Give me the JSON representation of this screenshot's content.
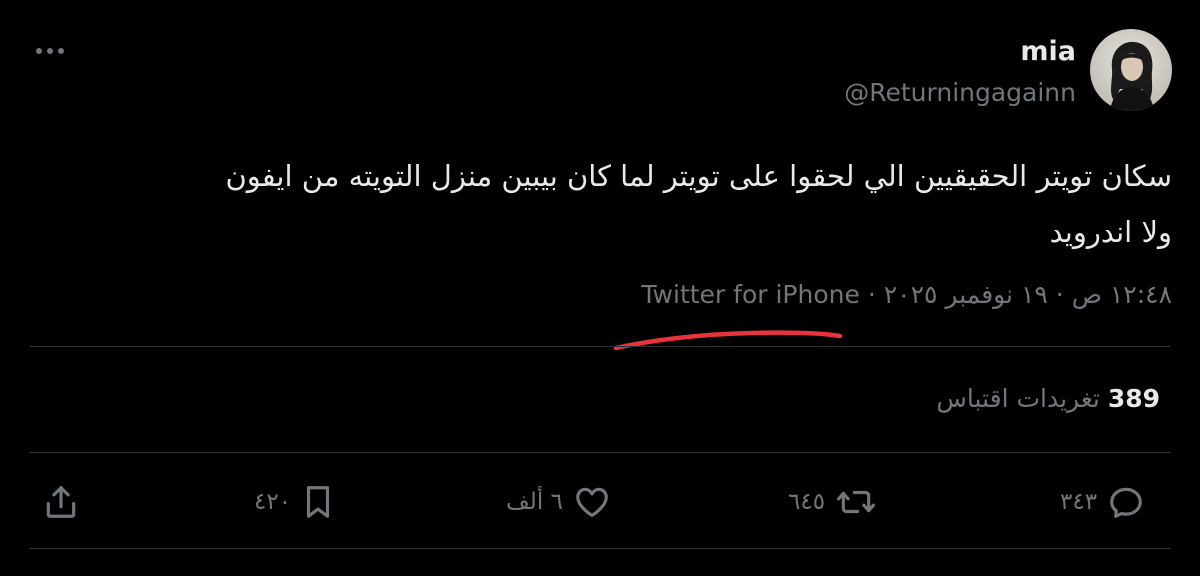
{
  "author": {
    "name": "mia",
    "handle": "@Returningagainn"
  },
  "tweet": {
    "text": "سكان تويتر الحقيقيين الي لحقوا على تويتر لما كان بيبين منزل التويته من ايفون\nولا اندرويد"
  },
  "meta": {
    "time": "١٢:٤٨ ص",
    "date": "١٩ نوفمبر ٢٠٢٥",
    "separator": "·",
    "source": "Twitter for iPhone"
  },
  "quotes": {
    "count": "389",
    "label": "تغريدات اقتباس"
  },
  "actions": {
    "reply_count": "٣٤٣",
    "retweet_count": "٦٤٥",
    "like_count": "٦ ألف",
    "bookmark_count": "٤٢٠"
  },
  "colors": {
    "background": "#000000",
    "primary_text": "#e7e9ea",
    "secondary_text": "#71767b",
    "divider": "#2f3336",
    "annotation": "#e8333a"
  },
  "icons": [
    "more-icon",
    "reply-icon",
    "retweet-icon",
    "like-icon",
    "bookmark-icon",
    "share-icon"
  ]
}
